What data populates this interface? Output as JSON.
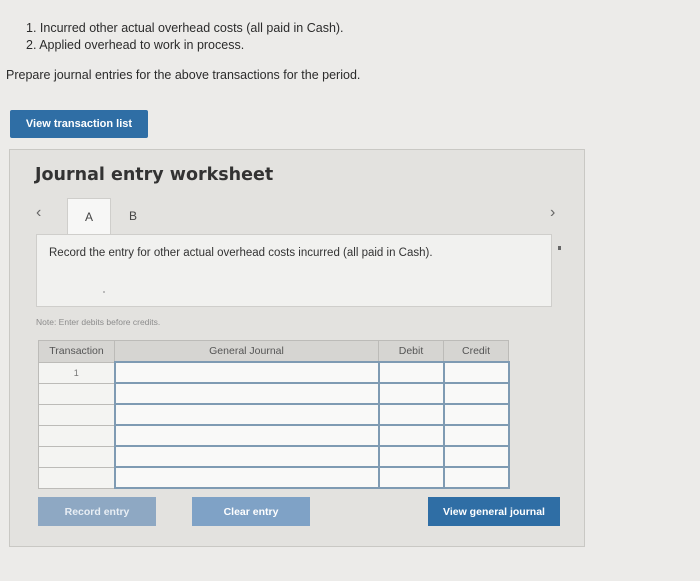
{
  "instructions": {
    "line1": "1. Incurred other actual overhead costs (all paid in Cash).",
    "line2": "2. Applied overhead to work in process."
  },
  "prompt": "Prepare journal entries for the above transactions for the period.",
  "view_transaction_button": "View transaction list",
  "worksheet": {
    "title": "Journal entry worksheet",
    "prev_icon": "chevron-left-icon",
    "next_icon": "chevron-right-icon",
    "tabs": [
      {
        "label": "A",
        "active": true
      },
      {
        "label": "B",
        "active": false
      }
    ],
    "entry_description": "Record the entry for other actual overhead costs incurred (all paid in Cash).",
    "note": "Note: Enter debits before credits.",
    "table": {
      "headers": [
        "Transaction",
        "General Journal",
        "Debit",
        "Credit"
      ],
      "rows": [
        {
          "transaction": "1",
          "account": "",
          "debit": "",
          "credit": ""
        },
        {
          "transaction": "",
          "account": "",
          "debit": "",
          "credit": ""
        },
        {
          "transaction": "",
          "account": "",
          "debit": "",
          "credit": ""
        },
        {
          "transaction": "",
          "account": "",
          "debit": "",
          "credit": ""
        },
        {
          "transaction": "",
          "account": "",
          "debit": "",
          "credit": ""
        },
        {
          "transaction": "",
          "account": "",
          "debit": "",
          "credit": ""
        }
      ]
    },
    "buttons": {
      "record": "Record entry",
      "clear": "Clear entry",
      "view_journal": "View general journal"
    }
  },
  "colors": {
    "primary_button": "#2f6ea5",
    "disabled_button": "#8ea8c3",
    "background": "#ecebe9"
  }
}
